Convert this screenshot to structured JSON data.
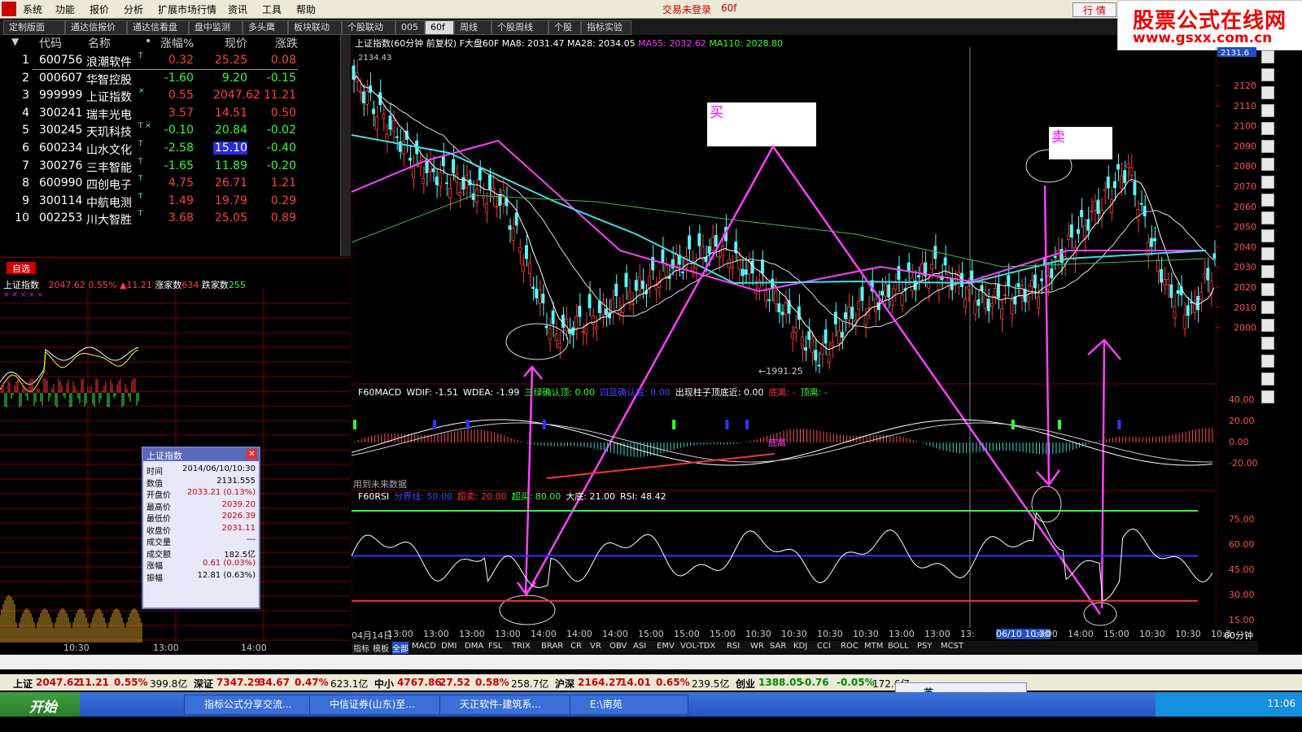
{
  "menubar": {
    "items": [
      "系统",
      "功能",
      "报价",
      "分析",
      "扩展市场行情",
      "资讯",
      "工具",
      "帮助"
    ],
    "login_status": "交易未登录",
    "period": "60f",
    "quote_button": "行  情"
  },
  "banner": {
    "line1": "股票公式在线网",
    "line2": "www.gsxx.com.cn"
  },
  "tabs": [
    "定制版面",
    "通达信报价",
    "通达信看盘",
    "盘中监测",
    "多头鹰",
    "板块联动",
    "个股联动",
    "005",
    "60f",
    "周线",
    "个股周线",
    "个股",
    "指标实验"
  ],
  "active_tab": "60f",
  "stock_table": {
    "headers": [
      "代码",
      "名称",
      "•",
      "涨幅%",
      "现价",
      "涨跌"
    ],
    "rows": [
      {
        "n": "1",
        "code": "600756",
        "name": "浪潮软件",
        "flag": "T",
        "chg": "0.32",
        "price": "25.25",
        "diff": "0.08",
        "dir": "up"
      },
      {
        "n": "2",
        "code": "000607",
        "name": "华智控股",
        "flag": "",
        "chg": "-1.60",
        "price": "9.20",
        "diff": "-0.15",
        "dir": "down"
      },
      {
        "n": "3",
        "code": "999999",
        "name": "上证指数",
        "flag": "×",
        "chg": "0.55",
        "price": "2047.62",
        "diff": "11.21",
        "dir": "up"
      },
      {
        "n": "4",
        "code": "300241",
        "name": "瑞丰光电",
        "flag": "",
        "chg": "3.57",
        "price": "14.51",
        "diff": "0.50",
        "dir": "up"
      },
      {
        "n": "5",
        "code": "300245",
        "name": "天玑科技",
        "flag": "T ×",
        "chg": "-0.10",
        "price": "20.84",
        "diff": "-0.02",
        "dir": "down"
      },
      {
        "n": "6",
        "code": "600234",
        "name": "山水文化",
        "flag": "T",
        "chg": "-2.58",
        "price": "15.10",
        "diff": "-0.40",
        "dir": "down"
      },
      {
        "n": "7",
        "code": "300276",
        "name": "三丰智能",
        "flag": "T",
        "chg": "-1.65",
        "price": "11.89",
        "diff": "-0.20",
        "dir": "down"
      },
      {
        "n": "8",
        "code": "600990",
        "name": "四创电子",
        "flag": "T",
        "chg": "4.75",
        "price": "26.71",
        "diff": "1.21",
        "dir": "up"
      },
      {
        "n": "9",
        "code": "300114",
        "name": "中航电测",
        "flag": "T",
        "chg": "1.49",
        "price": "19.79",
        "diff": "0.29",
        "dir": "up"
      },
      {
        "n": "10",
        "code": "002253",
        "name": "川大智胜",
        "flag": "T",
        "chg": "3.68",
        "price": "25.05",
        "diff": "0.89",
        "dir": "up"
      }
    ]
  },
  "watchlist_tab": "自选",
  "index_summary": {
    "name": "上证指数",
    "price": "2047.62",
    "pct": "0.55%",
    "diff": "▲11.21",
    "up_label": "涨家数",
    "up": "634",
    "down_label": "跌家数",
    "down": "255"
  },
  "intraday_axis": [
    "10:30",
    "13:00",
    "14:00"
  ],
  "popup": {
    "title": "上证指数",
    "rows": [
      {
        "k": "时间",
        "v": "2014/06/10/10:30",
        "r": false
      },
      {
        "k": "数值",
        "v": "2131.555",
        "r": false
      },
      {
        "k": "开盘价",
        "v": "2033.21 (0.13%)",
        "r": true
      },
      {
        "k": "最高价",
        "v": "2039.20",
        "r": true
      },
      {
        "k": "最低价",
        "v": "2026.39",
        "r": true
      },
      {
        "k": "收盘价",
        "v": "2031.11",
        "r": true
      },
      {
        "k": "成交量",
        "v": "---",
        "r": false
      },
      {
        "k": "成交额",
        "v": "182.5亿",
        "r": false
      },
      {
        "k": "涨幅",
        "v": "0.61 (0.03%)",
        "r": true
      },
      {
        "k": "振幅",
        "v": "12.81 (0.63%)",
        "r": false
      }
    ]
  },
  "chart_header": {
    "title": "上证指数(60分钟 前复权) F大盘60F",
    "ma8": "MA8: 2031.47",
    "ma28": "MA28: 2034.05",
    "ma55": "MA55: 2032.62",
    "ma110": "MA110: 2028.80"
  },
  "chart_labels": {
    "high": "2134.43",
    "low": "←1991.25",
    "buy": "买",
    "sell": "卖",
    "cursor_price": "2131.6",
    "future_note": "用到未来数据",
    "colors": {
      "ma8": "#ffffff",
      "ma28": "#ffffff",
      "ma55": "#ff40ff",
      "ma110": "#40ff40",
      "ma_cyan": "#40e0e0",
      "arrow": "#ff40ff"
    }
  },
  "macd_header": {
    "name": "F60MACD",
    "wdif": "WDIF: -1.51",
    "wdea": "WDEA: -1.99",
    "s1": "三绿确认顶: 0.00",
    "s2": "四蓝确认底: 0.00",
    "s3": "出现柱子顶底近: 0.00",
    "s4": "底离: -",
    "s5": "顶离: -",
    "marker": "底离"
  },
  "rsi_header": {
    "name": "F60RSI",
    "mid": "分界线: 50.00",
    "over_sell": "超卖: 20.00",
    "over_buy": "超买: 80.00",
    "big": "大底: 21.00",
    "rsi": "RSI: 48.42"
  },
  "price_axis": [
    "2120",
    "2110",
    "2100",
    "2090",
    "2080",
    "2070",
    "2060",
    "2050",
    "2040",
    "2030",
    "2020",
    "2010",
    "2000"
  ],
  "macd_axis": [
    "40.00",
    "20.00",
    "0.00",
    "-20.00"
  ],
  "rsi_axis": [
    "75.00",
    "60.00",
    "45.00",
    "30.00",
    "15.00"
  ],
  "time_axis": [
    "04月14日",
    "13:00",
    "13:00",
    "13:00",
    "13:00",
    "14:00",
    "14:00",
    "14:00",
    "15:00",
    "15:00",
    "15:00",
    "10:30",
    "10:30",
    "10:30",
    "10:30",
    "13:00",
    "13:00",
    "13:",
    "06/10 10:30",
    "14:00",
    "14:00",
    "15:00",
    "10:30",
    "10:30",
    "10:3"
  ],
  "period_label": "60分钟",
  "indicator_tabs": [
    "指标",
    "模板",
    "全部",
    "MACD",
    "DMI",
    "DMA",
    "FSL",
    "TRIX",
    "BRAR",
    "CR",
    "VR",
    "OBV",
    "ASI",
    "EMV",
    "VOL-TDX",
    "RSI",
    "WR",
    "SAR",
    "KDJ",
    "CCI",
    "ROC",
    "MTM",
    "BOLL",
    "PSY",
    "MCST"
  ],
  "ticker": [
    {
      "name": "上证",
      "price": "2047.62",
      "diff": "11.21",
      "pct": "0.55%",
      "amt": "399.8亿"
    },
    {
      "name": "深证",
      "price": "7347.29",
      "diff": "34.67",
      "pct": "0.47%",
      "amt": "623.1亿"
    },
    {
      "name": "中小",
      "price": "4767.86",
      "diff": "27.52",
      "pct": "0.58%",
      "amt": "258.7亿"
    },
    {
      "name": "沪深",
      "price": "2164.27",
      "diff": "14.01",
      "pct": "0.65%",
      "amt": "239.5亿"
    },
    {
      "name": "创业",
      "price": "1388.05",
      "diff": "-0.76",
      "pct": "-0.05%",
      "amt": "172.6亿"
    }
  ],
  "taskbar": {
    "start": "开始",
    "tasks": [
      "指标公式分享交流...",
      "中信证券(山东)至...",
      "天正软件-建筑系...",
      "E:\\南苑"
    ],
    "clock": "11:06"
  },
  "ime": "英"
}
